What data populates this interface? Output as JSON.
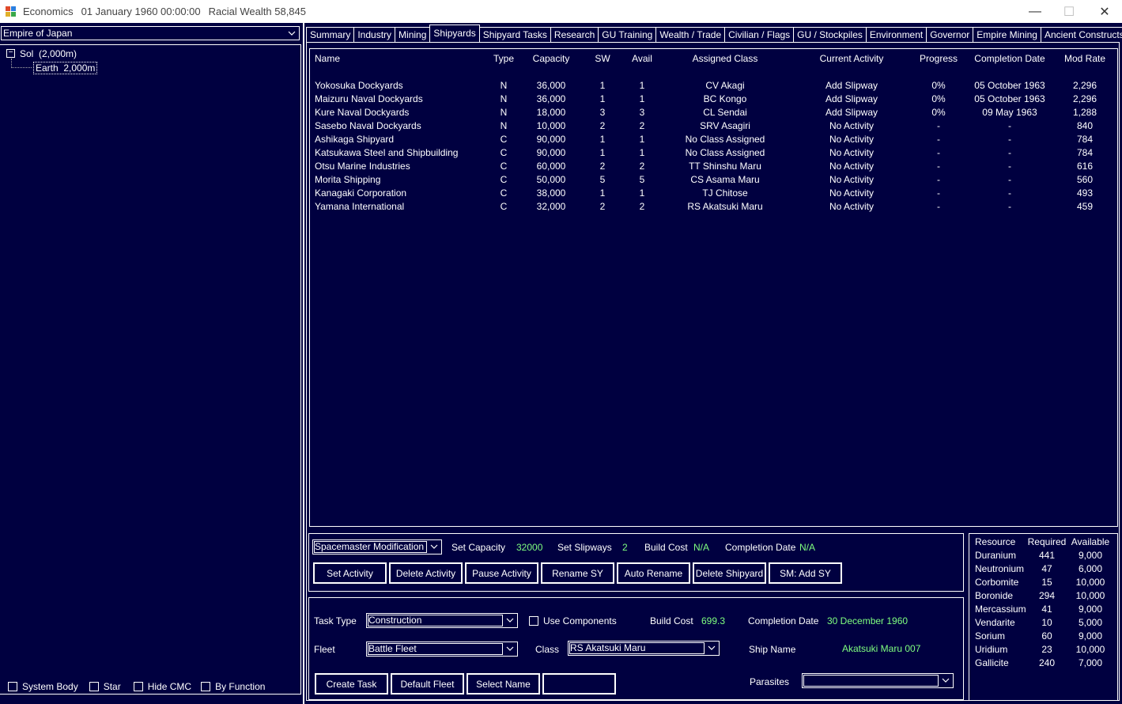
{
  "window": {
    "app": "Economics",
    "date": "01 January 1960 00:00:00",
    "wealth": "Racial Wealth 58,845",
    "minimize": "—",
    "maximize": "☐",
    "close": "✕"
  },
  "left": {
    "empire": "Empire of Japan",
    "tree": {
      "expander": "−",
      "root": "Sol  (2,000m)",
      "child": "Earth  2,000m"
    },
    "checkboxes": [
      "System Body",
      "Star",
      "Hide CMC",
      "By Function"
    ]
  },
  "tabs": [
    "Summary",
    "Industry",
    "Mining",
    "Shipyards",
    "Shipyard Tasks",
    "Research",
    "GU Training",
    "Wealth / Trade",
    "Civilian / Flags",
    "GU / Stockpiles",
    "Environment",
    "Governor",
    "Empire Mining",
    "Ancient Constructs"
  ],
  "active_tab": "Shipyards",
  "shipyards": {
    "headers": [
      "Name",
      "Type",
      "Capacity",
      "SW",
      "Avail",
      "Assigned Class",
      "Current Activity",
      "Progress",
      "Completion Date",
      "Mod Rate"
    ],
    "rows": [
      [
        "Yokosuka Dockyards",
        "N",
        "36,000",
        "1",
        "1",
        "CV Akagi",
        "Add Slipway",
        "0%",
        "05 October 1963",
        "2,296"
      ],
      [
        "Maizuru Naval Dockyards",
        "N",
        "36,000",
        "1",
        "1",
        "BC Kongo",
        "Add Slipway",
        "0%",
        "05 October 1963",
        "2,296"
      ],
      [
        "Kure Naval Dockyards",
        "N",
        "18,000",
        "3",
        "3",
        "CL Sendai",
        "Add Slipway",
        "0%",
        "09 May 1963",
        "1,288"
      ],
      [
        "Sasebo Naval Dockyards",
        "N",
        "10,000",
        "2",
        "2",
        "SRV Asagiri",
        "No Activity",
        "-",
        "-",
        "840"
      ],
      [
        "Ashikaga Shipyard",
        "C",
        "90,000",
        "1",
        "1",
        "No Class Assigned",
        "No Activity",
        "-",
        "-",
        "784"
      ],
      [
        "Katsukawa Steel and Shipbuilding",
        "C",
        "90,000",
        "1",
        "1",
        "No Class Assigned",
        "No Activity",
        "-",
        "-",
        "784"
      ],
      [
        "Otsu Marine Industries",
        "C",
        "60,000",
        "2",
        "2",
        "TT Shinshu Maru",
        "No Activity",
        "-",
        "-",
        "616"
      ],
      [
        "Morita Shipping",
        "C",
        "50,000",
        "5",
        "5",
        "CS Asama Maru",
        "No Activity",
        "-",
        "-",
        "560"
      ],
      [
        "Kanagaki Corporation",
        "C",
        "38,000",
        "1",
        "1",
        "TJ Chitose",
        "No Activity",
        "-",
        "-",
        "493"
      ],
      [
        "Yamana International",
        "C",
        "32,000",
        "2",
        "2",
        "RS Akatsuki Maru",
        "No Activity",
        "-",
        "-",
        "459"
      ]
    ]
  },
  "activity": {
    "type_value": "Spacemaster Modification",
    "set_capacity_label": "Set Capacity",
    "set_capacity_value": "32000",
    "set_slipways_label": "Set Slipways",
    "set_slipways_value": "2",
    "build_cost_label": "Build Cost",
    "build_cost_value": "N/A",
    "completion_label": "Completion Date",
    "completion_value": "N/A",
    "buttons": [
      "Set Activity",
      "Delete Activity",
      "Pause Activity",
      "Rename SY",
      "Auto Rename",
      "Delete Shipyard",
      "SM: Add SY"
    ]
  },
  "task": {
    "task_type_label": "Task Type",
    "task_type_value": "Construction",
    "use_components": "Use Components",
    "build_cost_label": "Build Cost",
    "build_cost_value": "699.3",
    "completion_label": "Completion Date",
    "completion_value": "30 December 1960",
    "fleet_label": "Fleet",
    "fleet_value": "Battle Fleet",
    "class_label": "Class",
    "class_value": "RS Akatsuki Maru",
    "ship_name_label": "Ship Name",
    "ship_name_value": "Akatsuki Maru 007",
    "parasites_label": "Parasites",
    "parasites_value": "",
    "buttons": [
      "Create Task",
      "Default Fleet",
      "Select Name",
      ""
    ]
  },
  "resources": {
    "headers": [
      "Resource",
      "Required",
      "Available"
    ],
    "rows": [
      [
        "Duranium",
        "441",
        "9,000"
      ],
      [
        "Neutronium",
        "47",
        "6,000"
      ],
      [
        "Corbomite",
        "15",
        "10,000"
      ],
      [
        "Boronide",
        "294",
        "10,000"
      ],
      [
        "Mercassium",
        "41",
        "9,000"
      ],
      [
        "Vendarite",
        "10",
        "5,000"
      ],
      [
        "Sorium",
        "60",
        "9,000"
      ],
      [
        "Uridium",
        "23",
        "10,000"
      ],
      [
        "Gallicite",
        "240",
        "7,000"
      ]
    ]
  }
}
